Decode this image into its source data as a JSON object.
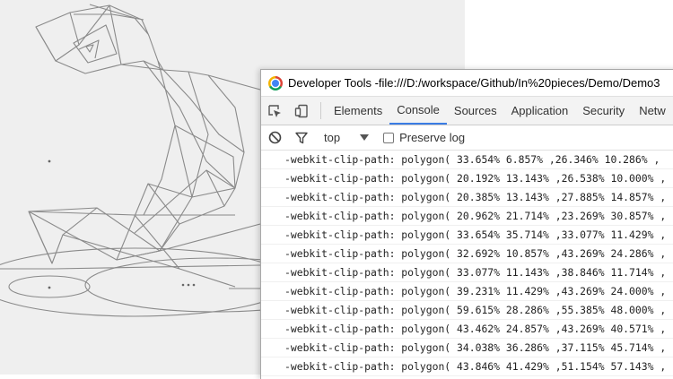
{
  "devtools": {
    "title_prefix": "Developer Tools - ",
    "title_url": "file:///D:/workspace/Github/In%20pieces/Demo/Demo3"
  },
  "tabs": [
    {
      "label": "Elements"
    },
    {
      "label": "Console"
    },
    {
      "label": "Sources"
    },
    {
      "label": "Application"
    },
    {
      "label": "Security"
    },
    {
      "label": "Netw"
    }
  ],
  "active_tab": "Console",
  "console": {
    "context": "top",
    "preserve_log_label": "Preserve log",
    "preserve_log_checked": false,
    "lines": [
      "-webkit-clip-path: polygon( 33.654% 6.857% ,26.346% 10.286% ,",
      "-webkit-clip-path: polygon( 20.192% 13.143% ,26.538% 10.000% ,",
      "-webkit-clip-path: polygon( 20.385% 13.143% ,27.885% 14.857% ,",
      "-webkit-clip-path: polygon( 20.962% 21.714% ,23.269% 30.857% ,",
      "-webkit-clip-path: polygon( 33.654% 35.714% ,33.077% 11.429% ,",
      "-webkit-clip-path: polygon( 32.692% 10.857% ,43.269% 24.286% ,",
      "-webkit-clip-path: polygon( 33.077% 11.143% ,38.846% 11.714% ,",
      "-webkit-clip-path: polygon( 39.231% 11.429% ,43.269% 24.000% ,",
      "-webkit-clip-path: polygon( 59.615% 28.286% ,55.385% 48.000% ,",
      "-webkit-clip-path: polygon( 43.462% 24.857% ,43.269% 40.571% ,",
      "-webkit-clip-path: polygon( 34.038% 36.286% ,37.115% 45.714% ,",
      "-webkit-clip-path: polygon( 43.846% 41.429% ,51.154% 57.143% ,"
    ]
  },
  "icons": {
    "inspect": "inspect-element-icon",
    "device": "device-toolbar-icon",
    "clear": "clear-console-icon",
    "filter": "filter-icon",
    "dropdown": "dropdown-arrow-icon",
    "chrome": "chrome-logo-icon"
  },
  "colors": {
    "page_background": "#efefef",
    "sketch_stroke": "#8a8a8a",
    "active_tab_underline": "#3b7de4"
  }
}
